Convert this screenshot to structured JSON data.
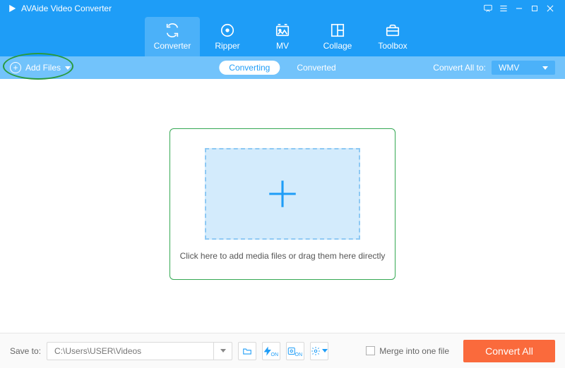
{
  "app": {
    "title": "AVAide Video Converter"
  },
  "tabs": {
    "converter": "Converter",
    "ripper": "Ripper",
    "mv": "MV",
    "collage": "Collage",
    "toolbox": "Toolbox"
  },
  "toolbar": {
    "add_files": "Add Files",
    "converting": "Converting",
    "converted": "Converted",
    "convert_all_to": "Convert All to:",
    "format_selected": "WMV"
  },
  "drop": {
    "text": "Click here to add media files or drag them here directly"
  },
  "bottom": {
    "save_to_label": "Save to:",
    "save_to_path": "C:\\Users\\USER\\Videos",
    "merge_label": "Merge into one file",
    "convert_all": "Convert All"
  }
}
